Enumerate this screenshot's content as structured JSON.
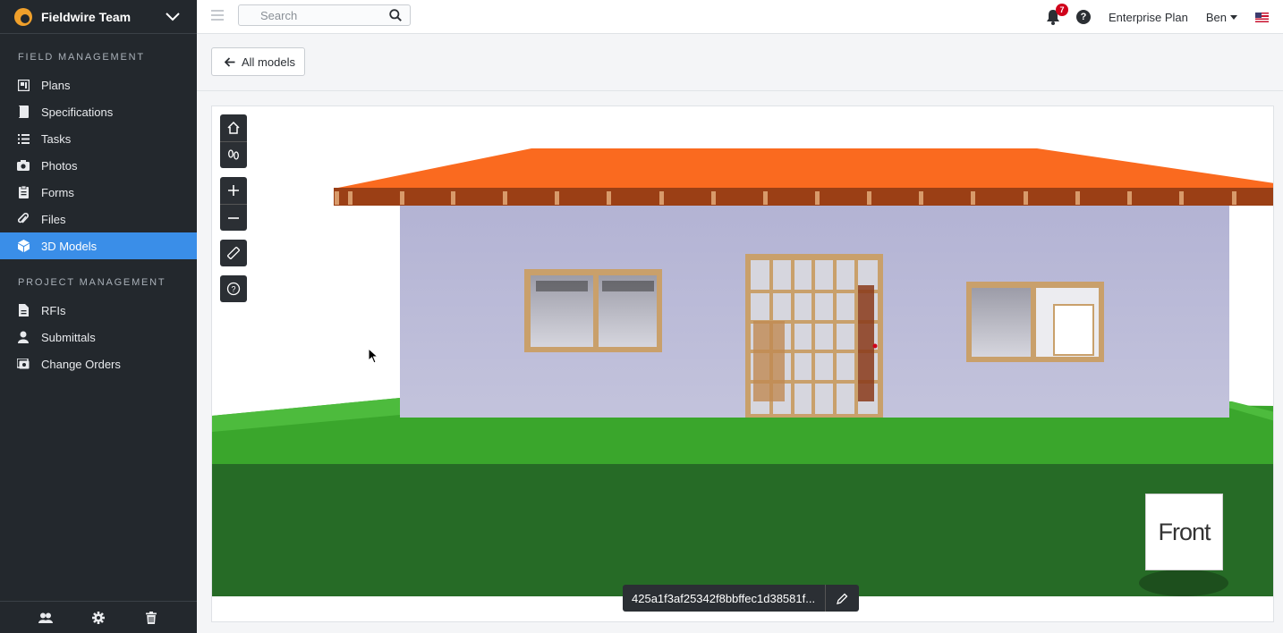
{
  "team": {
    "name": "Fieldwire Team"
  },
  "sidebar": {
    "sections": [
      {
        "title": "FIELD MANAGEMENT",
        "items": [
          {
            "label": "Plans",
            "icon": "plans-icon"
          },
          {
            "label": "Specifications",
            "icon": "specifications-icon"
          },
          {
            "label": "Tasks",
            "icon": "tasks-icon"
          },
          {
            "label": "Photos",
            "icon": "camera-icon"
          },
          {
            "label": "Forms",
            "icon": "forms-icon"
          },
          {
            "label": "Files",
            "icon": "paperclip-icon"
          },
          {
            "label": "3D Models",
            "icon": "cube-icon",
            "active": true
          }
        ]
      },
      {
        "title": "PROJECT MANAGEMENT",
        "items": [
          {
            "label": "RFIs",
            "icon": "rfi-icon"
          },
          {
            "label": "Submittals",
            "icon": "submittals-icon"
          },
          {
            "label": "Change Orders",
            "icon": "change-orders-icon"
          }
        ]
      }
    ],
    "footer_icons": [
      "people-icon",
      "gear-icon",
      "trash-icon"
    ]
  },
  "topbar": {
    "search_placeholder": "Search",
    "notifications_count": "7",
    "plan": "Enterprise Plan",
    "user": "Ben",
    "language_flag": "us-flag-icon"
  },
  "subheader": {
    "back_label": "All models"
  },
  "viewer": {
    "tools": [
      "home-icon",
      "footsteps-icon",
      "zoom-in-icon",
      "zoom-out-icon",
      "ruler-icon",
      "help-icon"
    ],
    "view_cube_label": "Front",
    "model_id": "425a1f3af25342f8bbffec1d38581f...",
    "colors": {
      "roof": "#fa6a1f",
      "fascia": "#9b3f15",
      "wall": "#b9b9d6",
      "lawn": "#3aa62c",
      "ground": "#266b26",
      "window_frame": "#c9a06b"
    }
  }
}
